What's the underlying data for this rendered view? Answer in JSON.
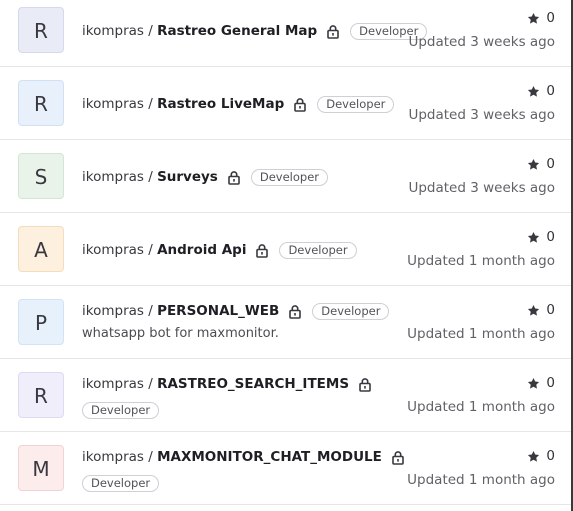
{
  "projects": [
    {
      "letter": "R",
      "namespace": "ikompras / ",
      "name": "Rastreo General Map",
      "badge": "Developer",
      "description": "",
      "stars": "0",
      "updated": "Updated 3 weeks ago",
      "avatar_bg": "#e9ebf6",
      "avatar_border": "#d5d9ee"
    },
    {
      "letter": "R",
      "namespace": "ikompras / ",
      "name": "Rastreo LiveMap",
      "badge": "Developer",
      "description": "",
      "stars": "0",
      "updated": "Updated 3 weeks ago",
      "avatar_bg": "#e7f0fb",
      "avatar_border": "#d0e1f5"
    },
    {
      "letter": "S",
      "namespace": "ikompras / ",
      "name": "Surveys",
      "badge": "Developer",
      "description": "",
      "stars": "0",
      "updated": "Updated 3 weeks ago",
      "avatar_bg": "#e9f3ea",
      "avatar_border": "#d2e6d4"
    },
    {
      "letter": "A",
      "namespace": "ikompras / ",
      "name": "Android Api",
      "badge": "Developer",
      "description": "",
      "stars": "0",
      "updated": "Updated 1 month ago",
      "avatar_bg": "#fdf0df",
      "avatar_border": "#f4dcbd"
    },
    {
      "letter": "P",
      "namespace": "ikompras / ",
      "name": "PERSONAL_WEB",
      "badge": "Developer",
      "description": "whatsapp bot for maxmonitor.",
      "stars": "0",
      "updated": "Updated 1 month ago",
      "avatar_bg": "#e7f1fb",
      "avatar_border": "#d1e3f5"
    },
    {
      "letter": "R",
      "namespace": "ikompras / ",
      "name": "RASTREO_SEARCH_ITEMS",
      "badge": "Developer",
      "description": "",
      "stars": "0",
      "updated": "Updated 1 month ago",
      "avatar_bg": "#f0eefb",
      "avatar_border": "#dedaf4"
    },
    {
      "letter": "M",
      "namespace": "ikompras / ",
      "name": "MAXMONITOR_CHAT_MODULE",
      "badge": "Developer",
      "description": "",
      "stars": "0",
      "updated": "Updated 1 month ago",
      "avatar_bg": "#fdecec",
      "avatar_border": "#f3d3d3"
    }
  ]
}
